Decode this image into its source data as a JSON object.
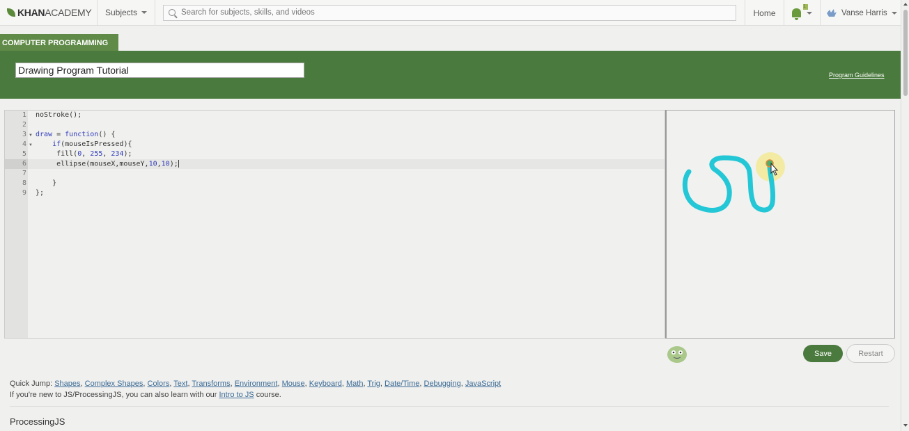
{
  "nav": {
    "logo_bold": "KHAN",
    "logo_light": "ACADEMY",
    "subjects_label": "Subjects",
    "search_placeholder": "Search for subjects, skills, and videos",
    "home_label": "Home",
    "notification_count": "1",
    "user_name": "Vanse Harris"
  },
  "header": {
    "tab_label": "COMPUTER PROGRAMMING",
    "program_title": "Drawing Program Tutorial",
    "guidelines_link": "Program Guidelines"
  },
  "editor": {
    "line_numbers": [
      "1",
      "2",
      "3",
      "4",
      "5",
      "6",
      "7",
      "8",
      "9"
    ],
    "active_line": "6",
    "lines": [
      "noStroke();",
      "",
      "draw = function() {",
      "    if(mouseIsPressed){",
      "     fill(0, 255, 234);",
      "     ellipse(mouseX,mouseY,10,10);",
      "",
      "    }",
      "};"
    ]
  },
  "canvas": {
    "stroke_color": "#24c7d6",
    "highlight_color": "#f3e88a"
  },
  "actions": {
    "save_label": "Save",
    "restart_label": "Restart"
  },
  "quick_jump": {
    "prefix": "Quick Jump:",
    "links": [
      "Shapes",
      "Complex Shapes",
      "Colors",
      "Text",
      "Transforms",
      "Environment",
      "Mouse",
      "Keyboard",
      "Math",
      "Trig",
      "Date/Time",
      "Debugging",
      "JavaScript"
    ],
    "intro_prefix": "If you're new to JS/ProcessingJS, you can also learn with our",
    "intro_link": "Intro to JS",
    "intro_suffix": "course."
  },
  "section": {
    "title": "ProcessingJS"
  },
  "colors": {
    "brand_green": "#4a7a3d",
    "tab_green": "#5f8a47",
    "link_blue": "#3b6b94"
  }
}
